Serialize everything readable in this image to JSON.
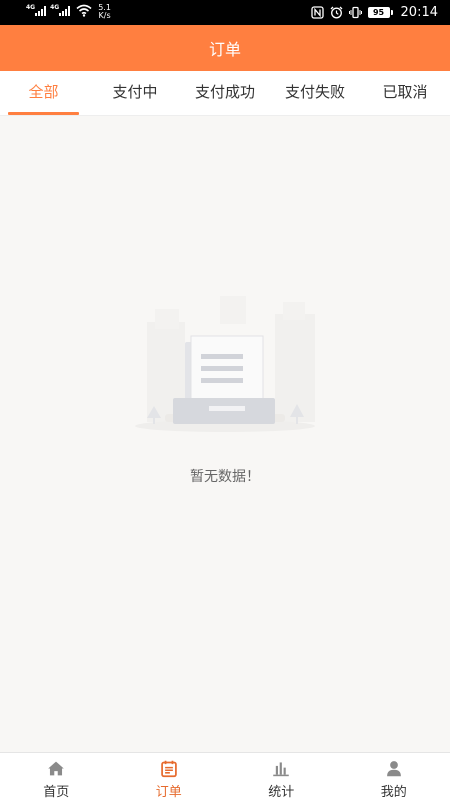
{
  "status_bar": {
    "network1": "4G",
    "network2": "4G",
    "speed_value": "5.1",
    "speed_unit": "K/s",
    "battery": "95",
    "time": "20:14"
  },
  "header": {
    "title": "订单"
  },
  "tabs": [
    {
      "label": "全部",
      "active": true
    },
    {
      "label": "支付中",
      "active": false
    },
    {
      "label": "支付成功",
      "active": false
    },
    {
      "label": "支付失败",
      "active": false
    },
    {
      "label": "已取消",
      "active": false
    }
  ],
  "empty_state": {
    "message": "暂无数据！"
  },
  "bottom_nav": [
    {
      "label": "首页",
      "icon": "home-icon",
      "active": false
    },
    {
      "label": "订单",
      "icon": "order-icon",
      "active": true
    },
    {
      "label": "统计",
      "icon": "stats-icon",
      "active": false
    },
    {
      "label": "我的",
      "icon": "profile-icon",
      "active": false
    }
  ],
  "colors": {
    "accent": "#ff7f40",
    "nav_active": "#e66b2e",
    "background": "#f8f7f5"
  }
}
